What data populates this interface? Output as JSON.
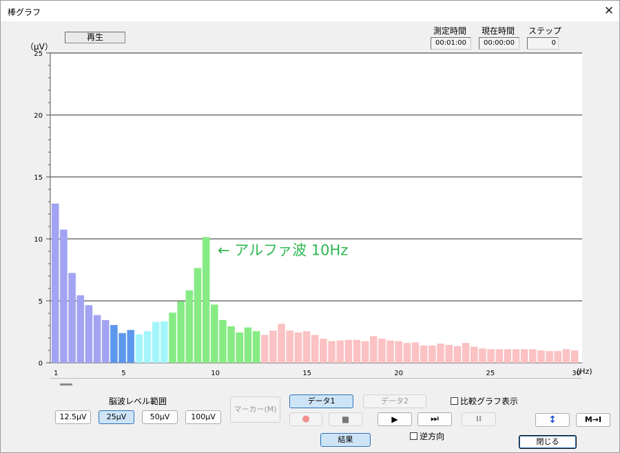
{
  "window": {
    "title": "棒グラフ",
    "close_glyph": "✕"
  },
  "status": {
    "text": "再生"
  },
  "info": {
    "measure_label": "測定時間",
    "measure_value": "00:01:00",
    "current_label": "現在時間",
    "current_value": "00:00:00",
    "step_label": "ステップ",
    "step_value": "0"
  },
  "chart_data": {
    "type": "bar",
    "ylabel": "（μV）",
    "xlabel_unit": "(Hz)",
    "ylim": [
      0,
      25
    ],
    "y_ticks": [
      0,
      5,
      10,
      15,
      20,
      25
    ],
    "x_tick_labels": [
      1,
      5,
      10,
      15,
      20,
      25,
      30
    ],
    "xlim": [
      1,
      30
    ],
    "grid": true,
    "annotation": "← アルファ波 10Hz",
    "annotation_color": "#2db84f",
    "values": [
      12.85,
      10.75,
      7.25,
      5.45,
      4.65,
      3.85,
      3.45,
      3.05,
      2.4,
      2.65,
      2.3,
      2.55,
      3.3,
      3.35,
      4.05,
      4.95,
      5.85,
      7.65,
      10.15,
      4.7,
      3.45,
      2.95,
      2.45,
      2.85,
      2.55,
      2.25,
      2.6,
      3.15,
      2.6,
      2.45,
      2.55,
      2.25,
      1.95,
      1.75,
      1.8,
      1.85,
      1.85,
      1.75,
      2.15,
      1.95,
      1.8,
      1.75,
      1.6,
      1.65,
      1.4,
      1.4,
      1.55,
      1.45,
      1.35,
      1.6,
      1.3,
      1.15,
      1.1,
      1.1,
      1.1,
      1.1,
      1.1,
      1.1,
      1.0,
      0.95,
      0.95,
      1.1,
      1.0
    ],
    "band_colors": [
      "#a2a3f2",
      "#5d97ed",
      "#a4f5fb",
      "#86eb84",
      "#fbc1c3"
    ],
    "bar_bands": [
      0,
      0,
      0,
      0,
      0,
      0,
      0,
      1,
      1,
      1,
      2,
      2,
      2,
      2,
      3,
      3,
      3,
      3,
      3,
      3,
      3,
      3,
      3,
      3,
      3,
      4,
      4,
      4,
      4,
      4,
      4,
      4,
      4,
      4,
      4,
      4,
      4,
      4,
      4,
      4,
      4,
      4,
      4,
      4,
      4,
      4,
      4,
      4,
      4,
      4,
      4,
      4,
      4,
      4,
      4,
      4,
      4,
      4,
      4,
      4,
      4,
      4,
      4
    ]
  },
  "controls": {
    "range_label": "脳波レベル範囲",
    "range_options": [
      "12.5μV",
      "25μV",
      "50μV",
      "100μV"
    ],
    "marker_label": "マーカー(M)",
    "data1_label": "データ1",
    "data2_label": "データ2",
    "compare_label": "比較グラフ表示",
    "reverse_label": "逆方向",
    "result_label": "結果",
    "close_label": "閉じる",
    "record_glyph": "●",
    "stop_glyph": "■",
    "play_glyph": "▶",
    "ffwd_glyph": "⏭",
    "pause_glyph": "II",
    "vresize_glyph": "↕",
    "jump_end_glyph": "M→I",
    "record_color": "#f28f8f",
    "vresize_color": "#1a4fd1"
  }
}
